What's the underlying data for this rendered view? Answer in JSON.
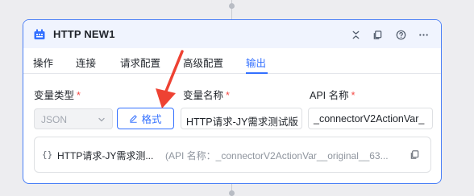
{
  "node": {
    "title": "HTTP NEW1"
  },
  "tabs": [
    {
      "label": "操作"
    },
    {
      "label": "连接"
    },
    {
      "label": "请求配置"
    },
    {
      "label": "高级配置"
    },
    {
      "label": "输出",
      "active": true
    }
  ],
  "fields": {
    "var_type_label": "变量类型",
    "var_name_label": "变量名称",
    "api_name_label": "API 名称",
    "required_mark": "*",
    "var_type_value": "JSON",
    "format_button": "格式",
    "var_name_value": "HTTP请求-JY需求测试版",
    "api_name_value": "_connectorV2ActionVar_"
  },
  "result": {
    "brace": "{}",
    "name": "HTTP请求-JY需求测...",
    "api_text": "(API 名称：_connectorV2ActionVar__original__63..."
  },
  "icons": {
    "node_icon": "http-node-icon",
    "collapse": "collapse-icon",
    "copy": "copy-icon",
    "help": "help-icon",
    "more": "more-icon",
    "edit": "edit-icon",
    "dropdown": "chevron-down-icon"
  },
  "colors": {
    "accent": "#3370ff",
    "card_border": "#4a7ff7",
    "required": "#f54a45",
    "annotation_arrow": "#ee4233"
  }
}
